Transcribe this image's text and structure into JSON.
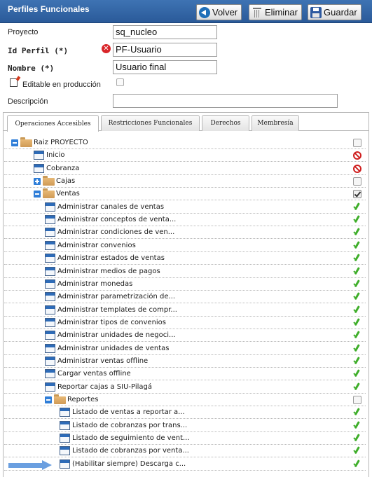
{
  "header": {
    "title": "Perfiles Funcionales",
    "buttons": {
      "back": "Volver",
      "delete": "Eliminar",
      "save": "Guardar"
    }
  },
  "form": {
    "proyecto": {
      "label": "Proyecto",
      "value": "sq_nucleo"
    },
    "id_perfil": {
      "label": "Id Perfil (*)",
      "value": "PF-Usuario"
    },
    "nombre": {
      "label": "Nombre (*)",
      "value": "Usuario final"
    },
    "editable": {
      "label": "Editable en producción",
      "checked": false
    },
    "descripcion": {
      "label": "Descripción",
      "value": ""
    }
  },
  "tabs": [
    "Operaciones Accesibles",
    "Restricciones Funcionales",
    "Derechos",
    "Membresía"
  ],
  "tree": [
    {
      "label": "Raiz PROYECTO",
      "type": "folder",
      "level": 0,
      "toggle": "minus",
      "status": "empty"
    },
    {
      "label": "Inicio",
      "type": "item",
      "level": 1,
      "status": "deny"
    },
    {
      "label": "Cobranza",
      "type": "item",
      "level": 1,
      "status": "deny"
    },
    {
      "label": "Cajas",
      "type": "folder",
      "level": 1,
      "toggle": "plus",
      "status": "empty"
    },
    {
      "label": "Ventas",
      "type": "folder",
      "level": 1,
      "toggle": "minus",
      "status": "checked"
    },
    {
      "label": "Administrar canales de ventas",
      "type": "item",
      "level": 2,
      "status": "ok"
    },
    {
      "label": "Administrar conceptos de venta...",
      "type": "item",
      "level": 2,
      "status": "ok"
    },
    {
      "label": "Administrar condiciones de ven...",
      "type": "item",
      "level": 2,
      "status": "ok"
    },
    {
      "label": "Administrar convenios",
      "type": "item",
      "level": 2,
      "status": "ok"
    },
    {
      "label": "Administrar estados de ventas",
      "type": "item",
      "level": 2,
      "status": "ok"
    },
    {
      "label": "Administrar medios de pagos",
      "type": "item",
      "level": 2,
      "status": "ok"
    },
    {
      "label": "Administrar monedas",
      "type": "item",
      "level": 2,
      "status": "ok"
    },
    {
      "label": "Administrar parametrización de...",
      "type": "item",
      "level": 2,
      "status": "ok"
    },
    {
      "label": "Administrar templates de compr...",
      "type": "item",
      "level": 2,
      "status": "ok"
    },
    {
      "label": "Administrar tipos de convenios",
      "type": "item",
      "level": 2,
      "status": "ok"
    },
    {
      "label": "Administrar unidades de negoci...",
      "type": "item",
      "level": 2,
      "status": "ok"
    },
    {
      "label": "Administrar unidades de ventas",
      "type": "item",
      "level": 2,
      "status": "ok"
    },
    {
      "label": "Administrar ventas offline",
      "type": "item",
      "level": 2,
      "status": "ok"
    },
    {
      "label": "Cargar ventas offline",
      "type": "item",
      "level": 2,
      "status": "ok"
    },
    {
      "label": "Reportar cajas a SIU-Pilagá",
      "type": "item",
      "level": 2,
      "status": "ok"
    },
    {
      "label": "Reportes",
      "type": "folder",
      "level": 2,
      "toggle": "minus",
      "status": "empty"
    },
    {
      "label": "Listado de ventas a reportar a...",
      "type": "item",
      "level": 3,
      "status": "ok"
    },
    {
      "label": "Listado de cobranzas por trans...",
      "type": "item",
      "level": 3,
      "status": "ok"
    },
    {
      "label": "Listado de seguimiento de vent...",
      "type": "item",
      "level": 3,
      "status": "ok"
    },
    {
      "label": "Listado de cobranzas por venta...",
      "type": "item",
      "level": 3,
      "status": "ok"
    },
    {
      "label": "(Habilitar siempre) Descarga c...",
      "type": "item",
      "level": 3,
      "status": "ok"
    }
  ],
  "colors": {
    "header": "#2a5a99",
    "accent": "#2f7ed8",
    "ok": "#3fae2a",
    "deny": "#cf1f1f",
    "annotation_arrow": "#6a9fe0"
  }
}
